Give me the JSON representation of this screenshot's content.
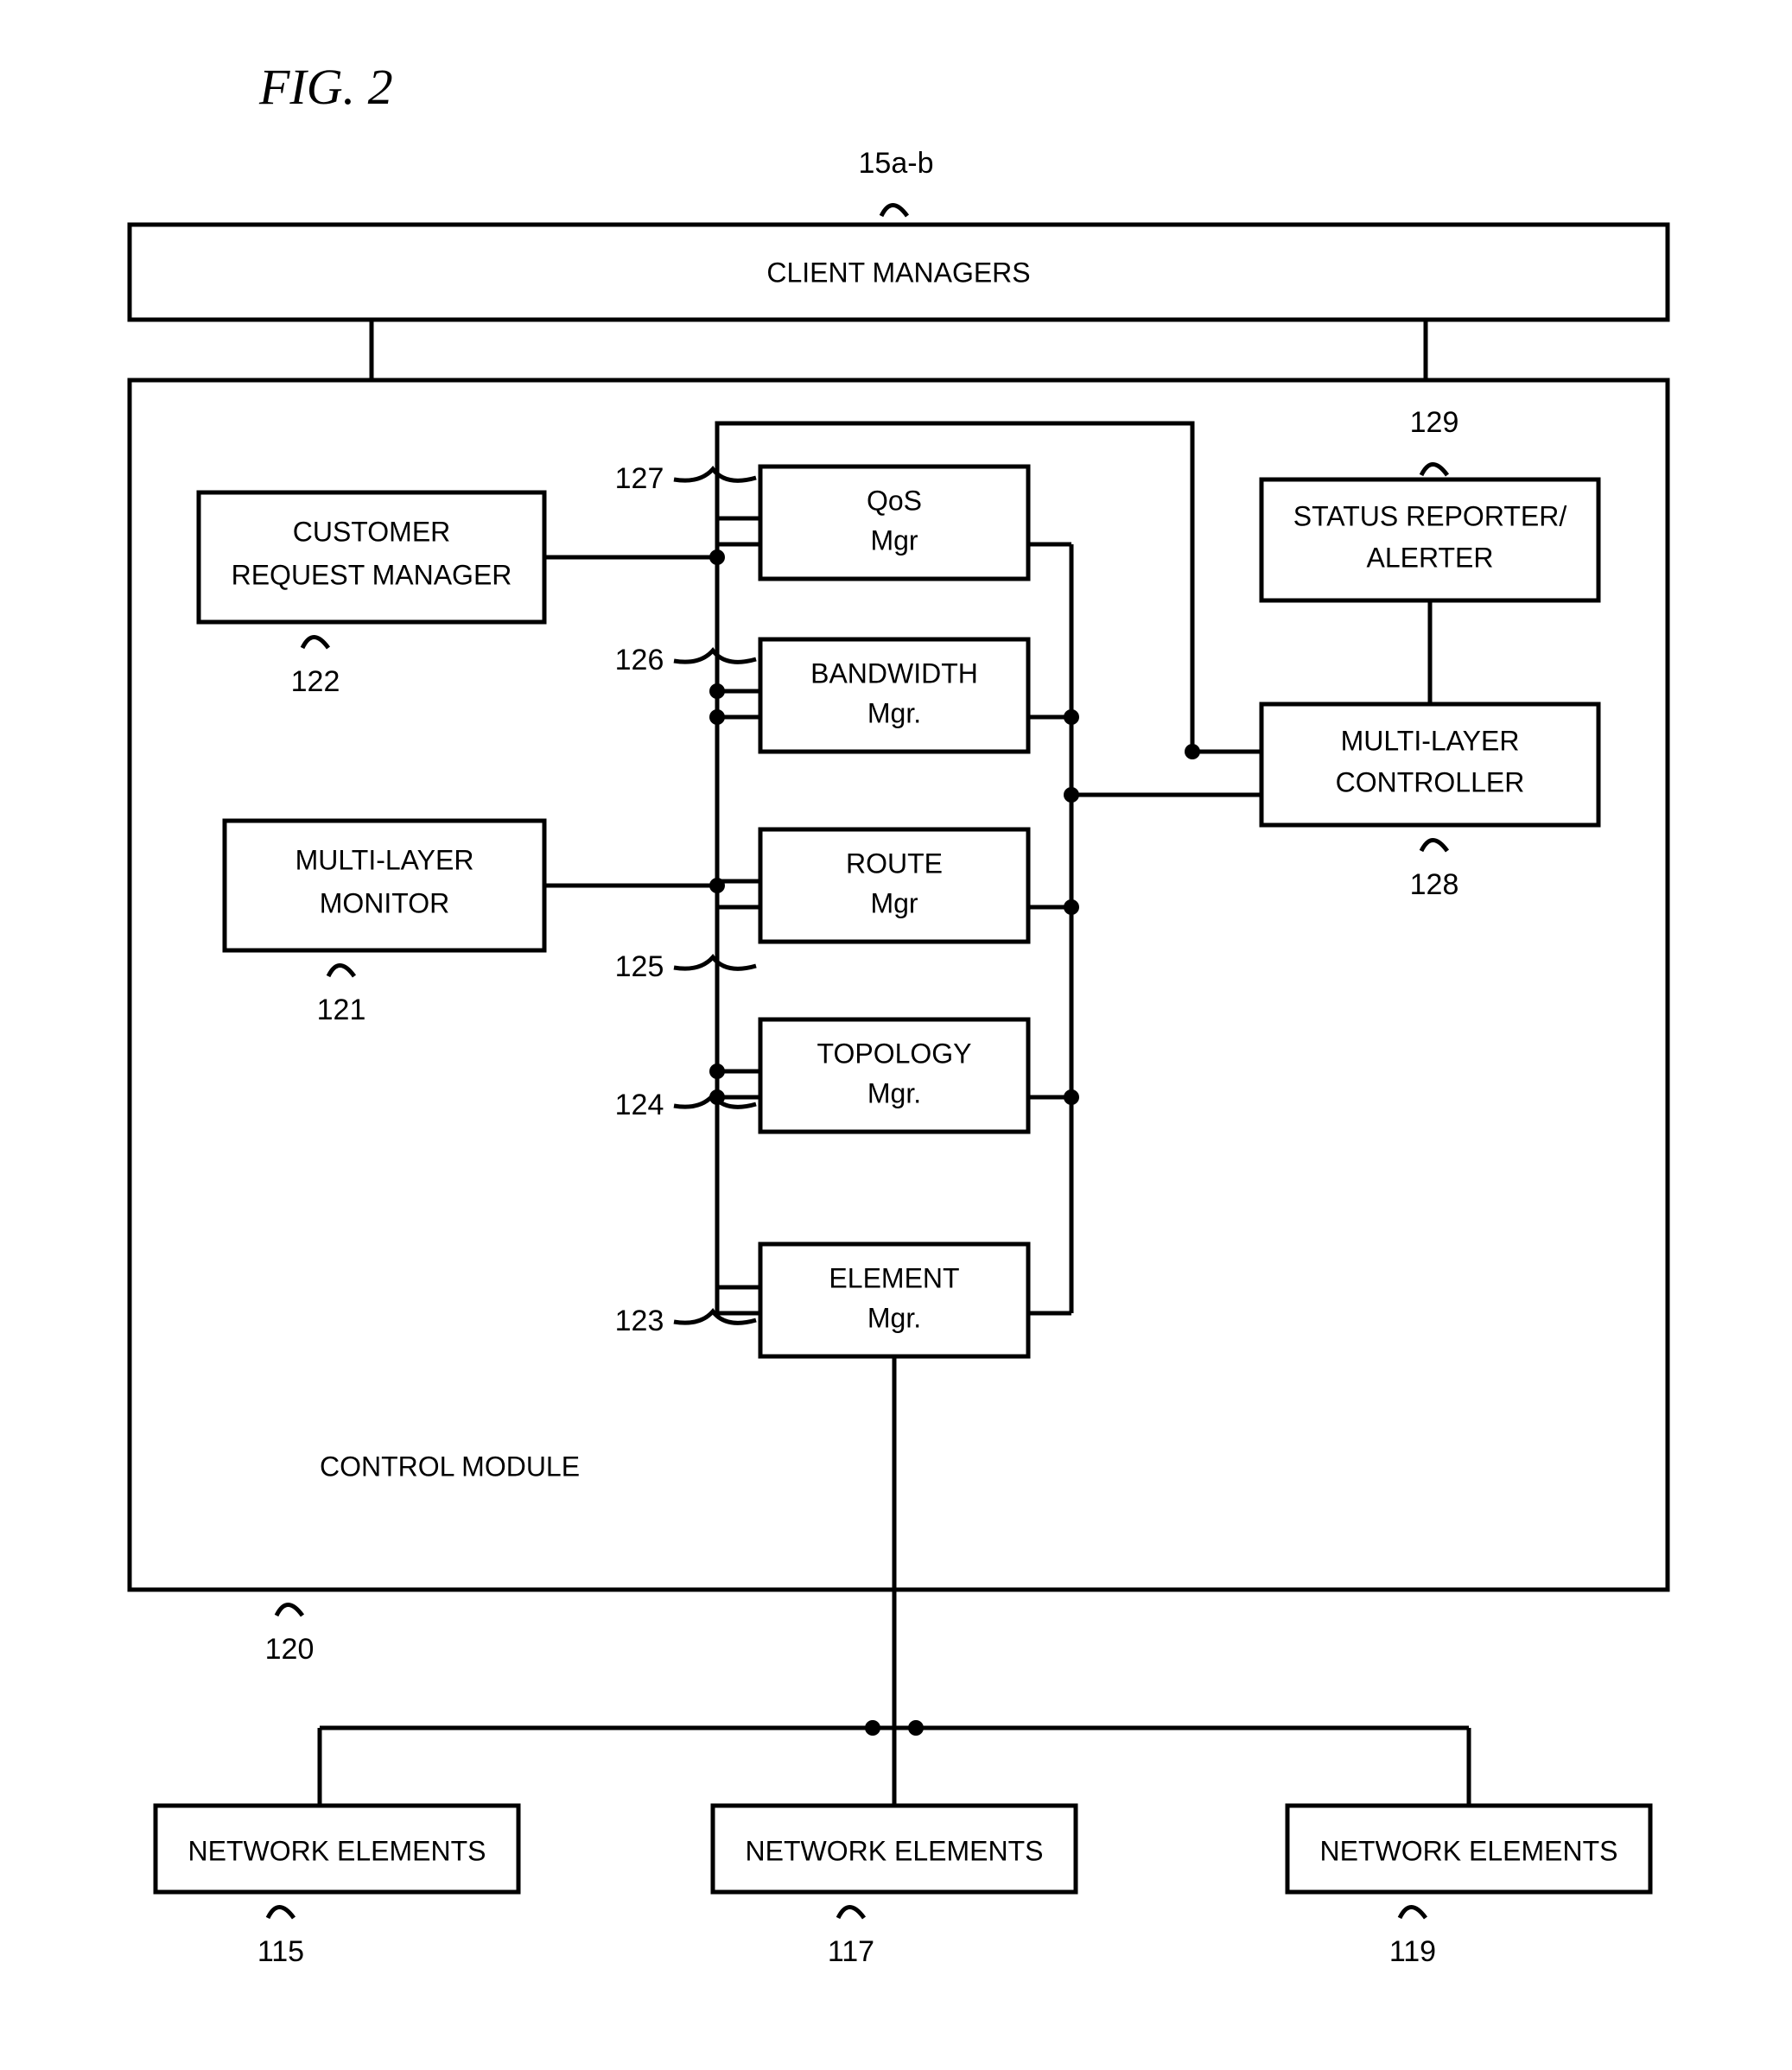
{
  "figure_label": "FIG. 2",
  "top": {
    "ref": "15a-b",
    "label": "CLIENT MANAGERS"
  },
  "control_module_label": "CONTROL MODULE",
  "control_module_ref": "120",
  "boxes": {
    "crm": {
      "ref": "122",
      "l1": "CUSTOMER",
      "l2": "REQUEST MANAGER"
    },
    "mon": {
      "ref": "121",
      "l1": "MULTI-LAYER",
      "l2": "MONITOR"
    },
    "qos": {
      "ref": "127",
      "l1": "QoS",
      "l2": "Mgr"
    },
    "bw": {
      "ref": "126",
      "l1": "BANDWIDTH",
      "l2": "Mgr."
    },
    "route": {
      "ref": "125",
      "l1": "ROUTE",
      "l2": "Mgr"
    },
    "topo": {
      "ref": "124",
      "l1": "TOPOLOGY",
      "l2": "Mgr."
    },
    "elem": {
      "ref": "123",
      "l1": "ELEMENT",
      "l2": "Mgr."
    },
    "status": {
      "ref": "129",
      "l1": "STATUS REPORTER/",
      "l2": "ALERTER"
    },
    "ctrl": {
      "ref": "128",
      "l1": "MULTI-LAYER",
      "l2": "CONTROLLER"
    }
  },
  "bottom": {
    "ne1": {
      "label": "NETWORK ELEMENTS",
      "ref": "115"
    },
    "ne2": {
      "label": "NETWORK ELEMENTS",
      "ref": "117"
    },
    "ne3": {
      "label": "NETWORK ELEMENTS",
      "ref": "119"
    }
  }
}
